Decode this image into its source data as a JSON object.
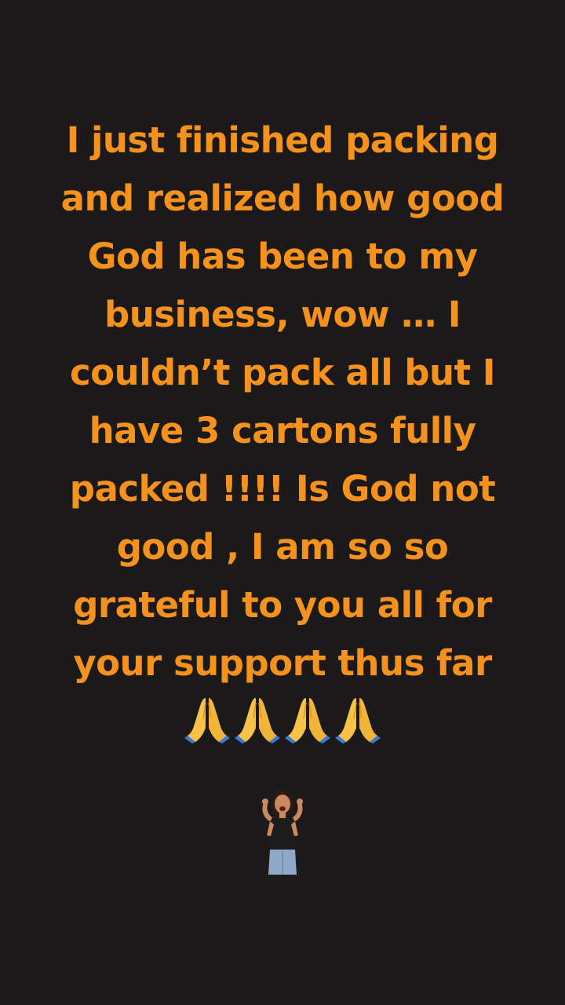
{
  "story": {
    "text_lines": [
      "I just finished packing",
      "and realized how good",
      "God has been to my",
      "business, wow … I",
      "couldn’t pack all but I",
      "have 3 cartons fully",
      "packed !!!! Is God not",
      "good , I am so so",
      "grateful to you all for",
      "your support thus far"
    ],
    "text_color": "#f5921e",
    "background_color": "#1b1919",
    "emoji_row": [
      "folded-hands-icon",
      "folded-hands-icon",
      "folded-hands-icon",
      "folded-hands-icon"
    ],
    "sticker": "excited-woman-sticker"
  }
}
